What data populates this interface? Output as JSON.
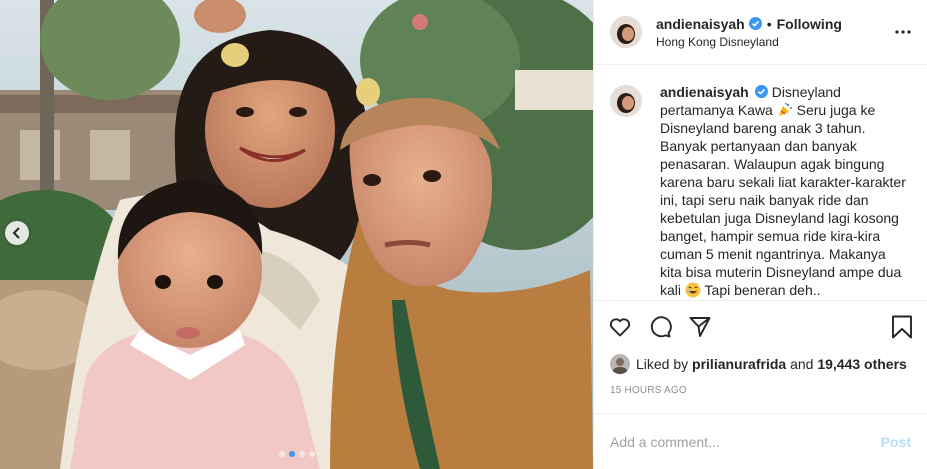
{
  "header": {
    "username": "andienaisyah",
    "separator": "•",
    "follow_status": "Following",
    "location": "Hong Kong Disneyland"
  },
  "caption": {
    "username": "andienaisyah",
    "text_1": "Disneyland pertamanya Kawa",
    "text_2": "Seru juga ke Disneyland bareng anak 3 tahun. Banyak pertanyaan dan banyak penasaran. Walaupun agak bingung karena baru sekali liat karakter-karakter ini, tapi seru naik banyak ride dan kebetulan juga Disneyland lagi kosong banget, hampir semua ride kira-kira cuman 5 menit ngantrinya. Makanya kita bisa muterin Disneyland ampe dua kali",
    "text_3": "Tapi beneran deh.."
  },
  "likes": {
    "prefix": "Liked by",
    "user": "prilianurafrida",
    "and": "and",
    "count": "19,443 others"
  },
  "timestamp": "15 HOURS AGO",
  "comment": {
    "placeholder": "Add a comment...",
    "post_label": "Post"
  },
  "carousel": {
    "total": 4,
    "active": 1
  },
  "icons": {
    "verified": "verified-badge-icon",
    "more": "more-options-icon",
    "like": "heart-icon",
    "comment": "comment-icon",
    "share": "paper-plane-icon",
    "save": "bookmark-icon",
    "prev": "chevron-left-icon"
  },
  "colors": {
    "verified": "#3897f0",
    "text": "#262626",
    "muted": "#8e8e8e",
    "post_disabled": "#b2dffc",
    "border": "#efefef"
  }
}
